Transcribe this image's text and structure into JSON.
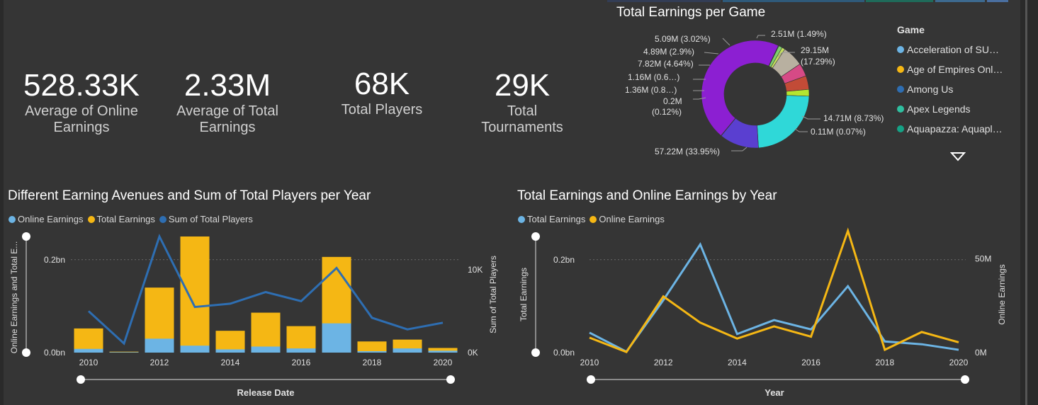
{
  "kpis": [
    {
      "value": "528.33K",
      "label1": "Average of Online",
      "label2": "Earnings"
    },
    {
      "value": "2.33M",
      "label1": "Average of Total",
      "label2": "Earnings"
    },
    {
      "value": "68K",
      "label1": "Total Players",
      "label2": ""
    },
    {
      "value": "29K",
      "label1": "Total",
      "label2": "Tournaments"
    }
  ],
  "pie": {
    "title": "Total Earnings per Game",
    "legend_title": "Game",
    "legend_items": [
      {
        "name": "Acceleration of SU…",
        "color": "#6cb4e4"
      },
      {
        "name": "Age of Empires Onl…",
        "color": "#f5b714"
      },
      {
        "name": "Among Us",
        "color": "#2e6eb2"
      },
      {
        "name": "Apex Legends",
        "color": "#2fbfa0"
      },
      {
        "name": "Aquapazza: Aquapl…",
        "color": "#15a286"
      }
    ],
    "slice_labels": [
      "2.51M (1.49%)",
      "29.15M",
      "(17.29%)",
      "14.71M (8.73%)",
      "0.11M (0.07%)",
      "57.22M (33.95%)",
      "0.2M",
      "(0.12%)",
      "1.36M (0.8…)",
      "1.16M (0.6…)",
      "7.82M (4.64%)",
      "4.89M (2.9%)",
      "5.09M (3.02%)"
    ]
  },
  "chart_data": [
    {
      "type": "bar",
      "title": "Different Earning Avenues and Sum of Total Players per Year",
      "xlabel": "Release Date",
      "ylabel": "Online Earnings and Total E...",
      "y2label": "Sum of Total Players",
      "categories": [
        2010,
        2011,
        2012,
        2013,
        2014,
        2015,
        2016,
        2017,
        2018,
        2019,
        2020
      ],
      "x_tick_labels": [
        "2010",
        "2012",
        "2014",
        "2016",
        "2018",
        "2020"
      ],
      "y_tick_labels": [
        "0.0bn",
        "0.2bn"
      ],
      "y2_tick_labels": [
        "0K",
        "10K"
      ],
      "ylim": [
        0,
        0.25
      ],
      "y2lim": [
        0,
        14000
      ],
      "legend": [
        "Online Earnings",
        "Total Earnings",
        "Sum of Total Players"
      ],
      "series": [
        {
          "name": "Online Earnings",
          "color": "#6cb4e4",
          "values": [
            0.008,
            0.001,
            0.03,
            0.015,
            0.007,
            0.013,
            0.009,
            0.063,
            0.003,
            0.009,
            0.004
          ]
        },
        {
          "name": "Total Earnings",
          "color": "#f5b714",
          "values": [
            0.052,
            0.002,
            0.14,
            0.25,
            0.047,
            0.086,
            0.057,
            0.206,
            0.024,
            0.028,
            0.01
          ]
        },
        {
          "name": "Sum of Total Players",
          "color": "#2e6eb2",
          "axis": "right",
          "values": [
            5000,
            1100,
            14000,
            5500,
            5900,
            7300,
            6200,
            10200,
            4200,
            2800,
            3600
          ]
        }
      ]
    },
    {
      "type": "line",
      "title": "Total Earnings and Online Earnings by Year",
      "xlabel": "Year",
      "ylabel": "Total Earnings",
      "y2label": "Online Earnings",
      "x": [
        2010,
        2011,
        2012,
        2013,
        2014,
        2015,
        2016,
        2017,
        2018,
        2019,
        2020
      ],
      "x_tick_labels": [
        "2010",
        "2012",
        "2014",
        "2016",
        "2018",
        "2020"
      ],
      "y_tick_labels": [
        "0.0bn",
        "0.2bn"
      ],
      "y2_tick_labels": [
        "0M",
        "50M"
      ],
      "ylim": [
        0,
        0.25
      ],
      "y2lim": [
        0,
        62000000
      ],
      "legend": [
        "Total Earnings",
        "Online Earnings"
      ],
      "series": [
        {
          "name": "Total Earnings",
          "color": "#6cb4e4",
          "axis": "left",
          "values": [
            0.043,
            0.002,
            0.113,
            0.233,
            0.04,
            0.07,
            0.05,
            0.143,
            0.024,
            0.018,
            0.006
          ]
        },
        {
          "name": "Online Earnings",
          "color": "#f5b714",
          "axis": "right",
          "values": [
            8000000,
            300000,
            30000000,
            16000000,
            7500000,
            14000000,
            8500000,
            65000000,
            1500000,
            11000000,
            5500000
          ]
        }
      ]
    },
    {
      "type": "pie",
      "title": "Total Earnings per Game",
      "slices": [
        {
          "value": 57.22,
          "color": "#8c1fd2"
        },
        {
          "value": 0.2,
          "color": "#2f8fd8"
        },
        {
          "value": 1.36,
          "color": "#7fd06d"
        },
        {
          "value": 1.16,
          "color": "#c6e060"
        },
        {
          "value": 7.82,
          "color": "#b8b0a0"
        },
        {
          "value": 4.89,
          "color": "#d64a86"
        },
        {
          "value": 5.09,
          "color": "#c24b37"
        },
        {
          "value": 2.51,
          "color": "#b5e630"
        },
        {
          "value": 29.15,
          "color": "#2fd8d8"
        },
        {
          "value": 14.71,
          "color": "#5a3fd0"
        },
        {
          "value": 0.11,
          "color": "#4a6fe0"
        }
      ]
    }
  ]
}
